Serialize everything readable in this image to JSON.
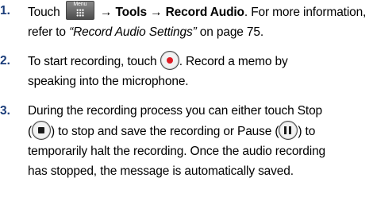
{
  "steps": [
    {
      "number": "1.",
      "touch": "Touch",
      "menu_key_label": "Menu",
      "arrow1": "→",
      "tools": "Tools",
      "arrow2": "→",
      "record_audio": "Record Audio",
      "more_info": ". For more information, refer to",
      "reference": "“Record Audio Settings”",
      "page_ref": "on page 75."
    },
    {
      "number": "2.",
      "lead": "To start recording, touch",
      "rest_line1": ". Record a memo by",
      "line2": "speaking into the microphone."
    },
    {
      "number": "3.",
      "line1": "During the recording process you can either touch Stop",
      "stop_open": "(",
      "stop_close": ") to stop and save the recording or Pause (",
      "pause_close": ") to",
      "line3": "temporarily halt the recording. Once the audio recording",
      "line4": "has stopped, the message is automatically saved."
    }
  ],
  "icons": {
    "menu": "menu-key-icon",
    "record": "record-icon",
    "stop": "stop-icon",
    "pause": "pause-icon"
  },
  "colors": {
    "step_number": "#1b3d7a",
    "record_dot": "#e01b24"
  }
}
